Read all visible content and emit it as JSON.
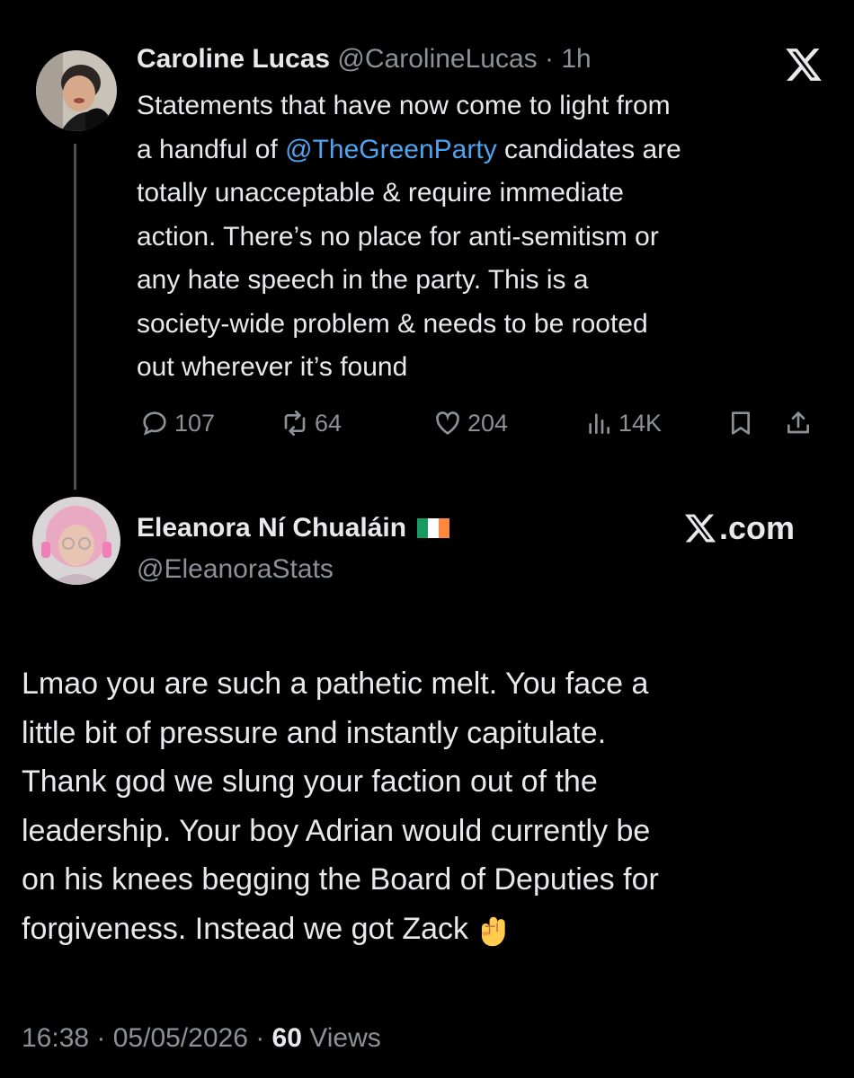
{
  "tweet": {
    "author_name": "Caroline Lucas",
    "author_handle": "@CarolineLucas",
    "separator": " · ",
    "time": "1h",
    "text_before": "Statements that have now come to light from\na handful of ",
    "mention": "@TheGreenParty",
    "text_after": " candidates are\ntotally unacceptable & require immediate\naction. There’s no place for anti-semitism or\nany hate speech in the party. This is a\nsociety-wide problem & needs to be rooted\nout wherever it’s found",
    "stats": {
      "replies": "107",
      "reposts": "64",
      "likes": "204",
      "views": "14K"
    }
  },
  "reply": {
    "author_name": "Eleanora Ní Chualáin",
    "author_handle": "@EleanoraStats",
    "site": ".com",
    "text": "Lmao you are such a pathetic melt. You face a\nlittle bit of pressure and instantly capitulate.\nThank god we slung your faction out of the\nleadership. Your boy Adrian would currently be\non his knees begging the Board of Deputies for\nforgiveness. Instead we got Zack",
    "emoji": "raised-fist",
    "footer": {
      "time_date": "16:38 · 05/05/2026 · ",
      "views_count": "60",
      "views_label": " Views"
    }
  },
  "colors": {
    "background": "#000000",
    "text": "#e7e9ea",
    "muted": "#8b9197",
    "link": "#4fa3ef",
    "thread_line": "#4a4f53",
    "flag_green": "#169b62",
    "flag_white": "#ffffff",
    "flag_orange": "#ff883e"
  }
}
